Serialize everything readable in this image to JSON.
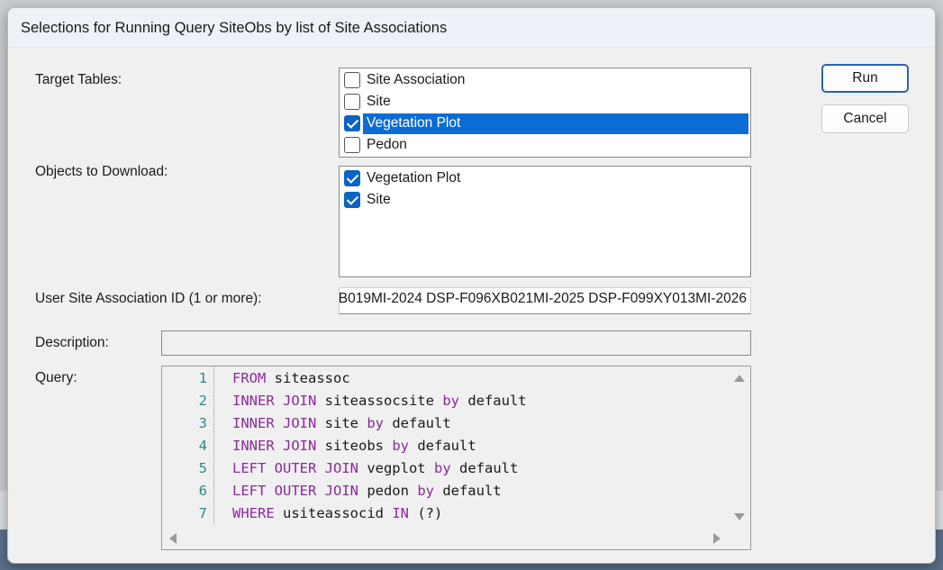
{
  "dialog": {
    "title": "Selections for Running Query SiteObs by list of Site Associations"
  },
  "labels": {
    "target_tables": "Target Tables:",
    "objects_to_download": "Objects to Download:",
    "user_site_assoc_id": "User Site Association ID (1 or more):",
    "description": "Description:",
    "query": "Query:"
  },
  "target_tables": [
    {
      "label": "Site Association",
      "checked": false,
      "selected": false
    },
    {
      "label": "Site",
      "checked": false,
      "selected": false
    },
    {
      "label": "Vegetation Plot",
      "checked": true,
      "selected": true
    },
    {
      "label": "Pedon",
      "checked": false,
      "selected": false
    }
  ],
  "objects_to_download": [
    {
      "label": "Vegetation Plot",
      "checked": true
    },
    {
      "label": "Site",
      "checked": true
    }
  ],
  "user_site_assoc_id": {
    "value": "B019MI-2024 DSP-F096XB021MI-2025 DSP-F099XY013MI-2026"
  },
  "description": {
    "value": ""
  },
  "buttons": {
    "run": "Run",
    "cancel": "Cancel"
  },
  "query_lines": [
    {
      "num": "1",
      "parts": [
        [
          "kw",
          "FROM"
        ],
        [
          "id",
          " siteassoc"
        ]
      ]
    },
    {
      "num": "2",
      "parts": [
        [
          "kw",
          "INNER JOIN"
        ],
        [
          "id",
          " siteassocsite "
        ],
        [
          "kw",
          "by"
        ],
        [
          "id",
          " default"
        ]
      ]
    },
    {
      "num": "3",
      "parts": [
        [
          "kw",
          "INNER JOIN"
        ],
        [
          "id",
          " site "
        ],
        [
          "kw",
          "by"
        ],
        [
          "id",
          " default"
        ]
      ]
    },
    {
      "num": "4",
      "parts": [
        [
          "kw",
          "INNER JOIN"
        ],
        [
          "id",
          " siteobs "
        ],
        [
          "kw",
          "by"
        ],
        [
          "id",
          " default"
        ]
      ]
    },
    {
      "num": "5",
      "parts": [
        [
          "kw",
          "LEFT OUTER JOIN"
        ],
        [
          "id",
          " vegplot "
        ],
        [
          "kw",
          "by"
        ],
        [
          "id",
          " default"
        ]
      ]
    },
    {
      "num": "6",
      "parts": [
        [
          "kw",
          "LEFT OUTER JOIN"
        ],
        [
          "id",
          " pedon "
        ],
        [
          "kw",
          "by"
        ],
        [
          "id",
          " default"
        ]
      ]
    },
    {
      "num": "7",
      "parts": [
        [
          "kw",
          "WHERE"
        ],
        [
          "id",
          " usiteassocid "
        ],
        [
          "kw",
          "IN"
        ],
        [
          "id",
          " (?)"
        ]
      ]
    }
  ],
  "colors": {
    "selection": "#0a6cd4",
    "keyword": "#8b2a9a",
    "line_number": "#2a8a8a",
    "default_button_border": "#2a64b0"
  }
}
